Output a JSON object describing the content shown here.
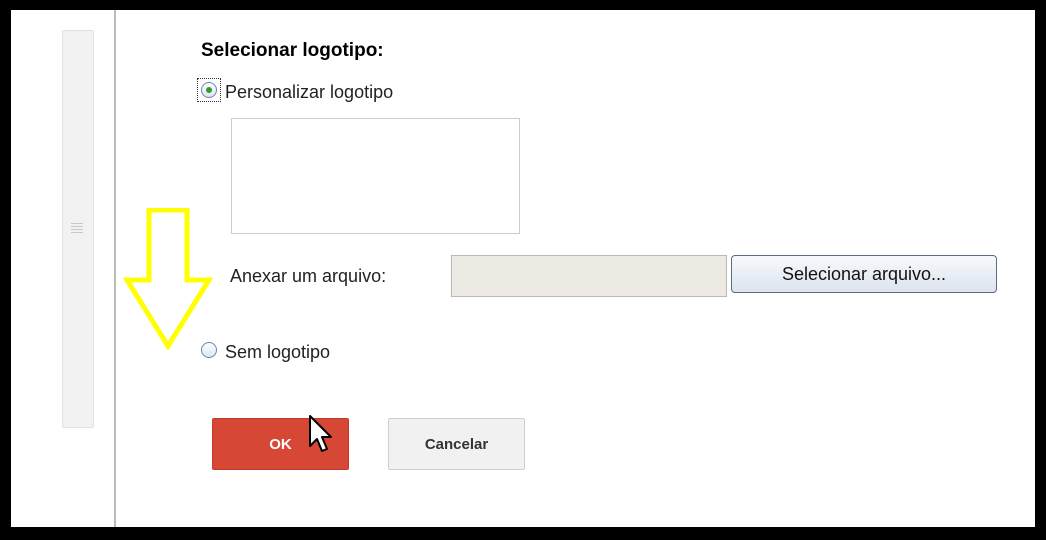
{
  "section_title": "Selecionar logotipo:",
  "options": {
    "custom_logo_label": "Personalizar logotipo",
    "custom_logo_selected": true,
    "no_logo_label": "Sem logotipo",
    "no_logo_selected": false
  },
  "attach": {
    "label": "Anexar um arquivo:",
    "file_value": "",
    "select_button": "Selecionar arquivo..."
  },
  "actions": {
    "ok_label": "OK",
    "cancel_label": "Cancelar"
  },
  "colors": {
    "ok_button": "#d64835",
    "annotation_arrow": "#ffff00",
    "radio_selected": "#2e9d2e"
  },
  "icons": {
    "annotation": "down-arrow-icon",
    "cursor": "mouse-pointer-icon"
  }
}
